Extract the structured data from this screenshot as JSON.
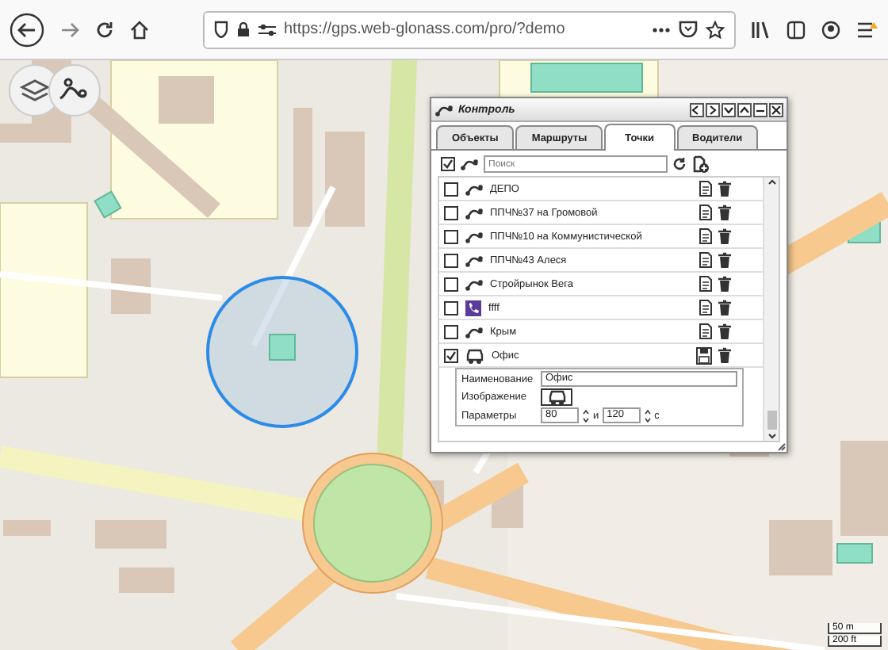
{
  "browser": {
    "url": "https://gps.web-glonass.com/pro/?demo"
  },
  "panel": {
    "title": "Контроль",
    "tabs": [
      {
        "label": "Объекты",
        "selected": false
      },
      {
        "label": "Маршруты",
        "selected": false
      },
      {
        "label": "Точки",
        "selected": true
      },
      {
        "label": "Водители",
        "selected": false
      }
    ],
    "select_all": {
      "checked": true
    },
    "search": {
      "placeholder": "Поиск"
    },
    "points": [
      {
        "name": "ДЕПО",
        "kind": "route",
        "checked": false,
        "expanded": false
      },
      {
        "name": "ППЧ№37 на Громовой",
        "kind": "route",
        "checked": false,
        "expanded": false
      },
      {
        "name": "ППЧ№10 на Коммунистической",
        "kind": "route",
        "checked": false,
        "expanded": false
      },
      {
        "name": "ППЧ№43 Алеся",
        "kind": "route",
        "checked": false,
        "expanded": false
      },
      {
        "name": "Стройрынок Вега",
        "kind": "route",
        "checked": false,
        "expanded": false
      },
      {
        "name": "ffff",
        "kind": "phone",
        "checked": false,
        "expanded": false
      },
      {
        "name": "Крым",
        "kind": "route",
        "checked": false,
        "expanded": false
      },
      {
        "name": "Офис",
        "kind": "car",
        "checked": true,
        "expanded": true
      }
    ],
    "details": {
      "name_label": "Наименование",
      "name_value": "Офис",
      "image_label": "Изображение",
      "params_label": "Параметры",
      "param_1": "80",
      "separator": "и",
      "param_2": "120",
      "unit": "с"
    }
  },
  "map": {
    "scale": [
      "50 m",
      "200 ft"
    ]
  }
}
